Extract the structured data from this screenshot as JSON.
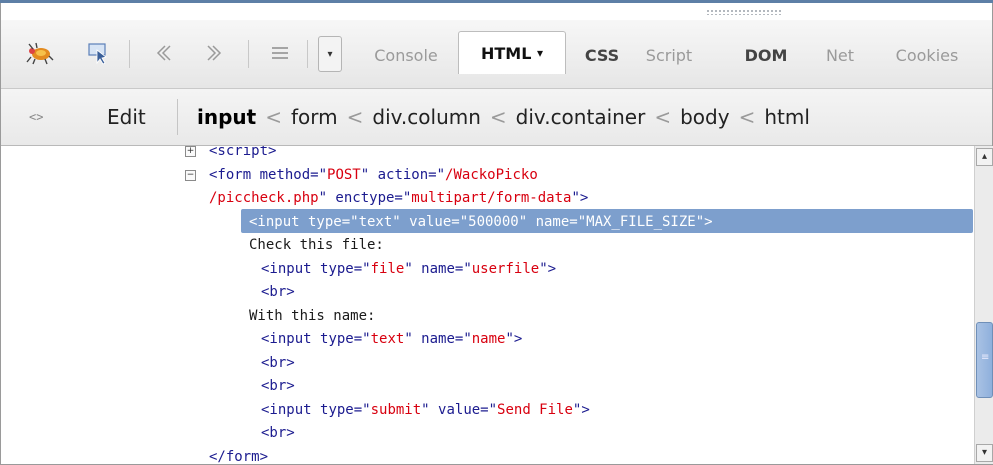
{
  "toolbar": {
    "icons": [
      "firebug-icon",
      "inspect-pointer-icon",
      "back-icon",
      "forward-icon",
      "list-icon",
      "dropdown-icon"
    ],
    "tabs": [
      {
        "label": "Console",
        "selected": false
      },
      {
        "label": "HTML",
        "selected": true,
        "arrow": "▾"
      },
      {
        "label": "CSS",
        "selected": false
      },
      {
        "label": "Script",
        "selected": false
      },
      {
        "label": "DOM",
        "selected": false
      },
      {
        "label": "Net",
        "selected": false
      },
      {
        "label": "Cookies",
        "selected": false
      }
    ]
  },
  "breadcrumb": {
    "edit_label": "Edit",
    "items": [
      "input",
      "form",
      "div.column",
      "div.container",
      "body",
      "html"
    ],
    "separator": "<"
  },
  "code": {
    "lines": [
      {
        "indent": 0,
        "toggle": "+",
        "segments": [
          [
            "tag",
            "<script>"
          ]
        ]
      },
      {
        "indent": 0,
        "toggle": "-",
        "segments": [
          [
            "tag",
            "<form "
          ],
          [
            "attr",
            "method=\""
          ],
          [
            "val",
            "POST"
          ],
          [
            "attr",
            "\" action=\""
          ],
          [
            "val",
            "/WackoPicko"
          ]
        ]
      },
      {
        "indent": 1,
        "segments": [
          [
            "val",
            "/piccheck.php"
          ],
          [
            "attr",
            "\" enctype=\""
          ],
          [
            "val",
            "multipart/form-data"
          ],
          [
            "tag",
            "\">"
          ]
        ]
      },
      {
        "indent": 2,
        "highlight": true,
        "segments": [
          [
            "tag",
            "<input type=\"text\" value=\"500000\" name=\"MAX_FILE_SIZE\">"
          ]
        ]
      },
      {
        "indent": 2,
        "segments": [
          [
            "txt",
            "Check this file:"
          ]
        ]
      },
      {
        "indent": 3,
        "segments": [
          [
            "tag",
            "<input "
          ],
          [
            "attr",
            "type=\""
          ],
          [
            "val",
            "file"
          ],
          [
            "attr",
            "\" name=\""
          ],
          [
            "val",
            "userfile"
          ],
          [
            "tag",
            "\">"
          ]
        ]
      },
      {
        "indent": 3,
        "segments": [
          [
            "tag",
            "<br>"
          ]
        ]
      },
      {
        "indent": 2,
        "segments": [
          [
            "txt",
            "With this name:"
          ]
        ]
      },
      {
        "indent": 3,
        "segments": [
          [
            "tag",
            "<input "
          ],
          [
            "attr",
            "type=\""
          ],
          [
            "val",
            "text"
          ],
          [
            "attr",
            "\" name=\""
          ],
          [
            "val",
            "name"
          ],
          [
            "tag",
            "\">"
          ]
        ]
      },
      {
        "indent": 3,
        "segments": [
          [
            "tag",
            "<br>"
          ]
        ]
      },
      {
        "indent": 3,
        "segments": [
          [
            "tag",
            "<br>"
          ]
        ]
      },
      {
        "indent": 3,
        "segments": [
          [
            "tag",
            "<input "
          ],
          [
            "attr",
            "type=\""
          ],
          [
            "val",
            "submit"
          ],
          [
            "attr",
            "\" value=\""
          ],
          [
            "val",
            "Send File"
          ],
          [
            "tag",
            "\">"
          ]
        ]
      },
      {
        "indent": 3,
        "segments": [
          [
            "tag",
            "<br>"
          ]
        ]
      },
      {
        "indent": 1,
        "segments": [
          [
            "tag",
            "</form>"
          ]
        ]
      }
    ]
  },
  "scrollbar": {
    "up_arrow": "▴",
    "down_arrow": "▾",
    "grip": "≡"
  }
}
